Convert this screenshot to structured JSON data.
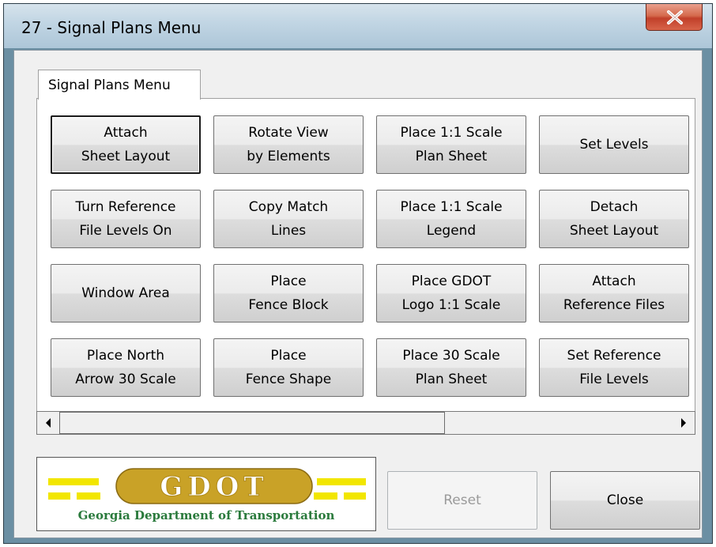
{
  "window": {
    "title": "27 - Signal Plans Menu",
    "close_icon": "close-x-icon"
  },
  "tab": {
    "label": "Signal Plans Menu"
  },
  "buttons": [
    {
      "label": "Attach\nSheet Layout",
      "default": true
    },
    {
      "label": "Rotate View\nby Elements"
    },
    {
      "label": "Place 1:1 Scale\nPlan Sheet"
    },
    {
      "label": "Set Levels"
    },
    {
      "label": "Turn Reference\nFile Levels On"
    },
    {
      "label": "Copy Match\nLines"
    },
    {
      "label": "Place 1:1 Scale\nLegend"
    },
    {
      "label": "Detach\nSheet Layout"
    },
    {
      "label": "Window Area"
    },
    {
      "label": "Place\nFence Block"
    },
    {
      "label": "Place GDOT\nLogo 1:1 Scale"
    },
    {
      "label": "Attach\nReference Files"
    },
    {
      "label": "Place North\nArrow 30 Scale"
    },
    {
      "label": "Place\nFence Shape"
    },
    {
      "label": "Place 30 Scale\nPlan Sheet"
    },
    {
      "label": "Set Reference\nFile Levels"
    }
  ],
  "scrollbar": {
    "left_arrow": "left-arrow-icon",
    "right_arrow": "right-arrow-icon",
    "position": 0.0
  },
  "logo": {
    "wordmark": "GDOT",
    "caption": "Georgia Department of Transportation",
    "accent": "#f2e600",
    "gold": "#c9a227",
    "green": "#2a7a3c"
  },
  "footer": {
    "reset_label": "Reset",
    "close_label": "Close"
  },
  "colors": {
    "title_bar": "#c2d6e4",
    "close_red": "#c1402a",
    "client_bg": "#f0f0f0"
  }
}
